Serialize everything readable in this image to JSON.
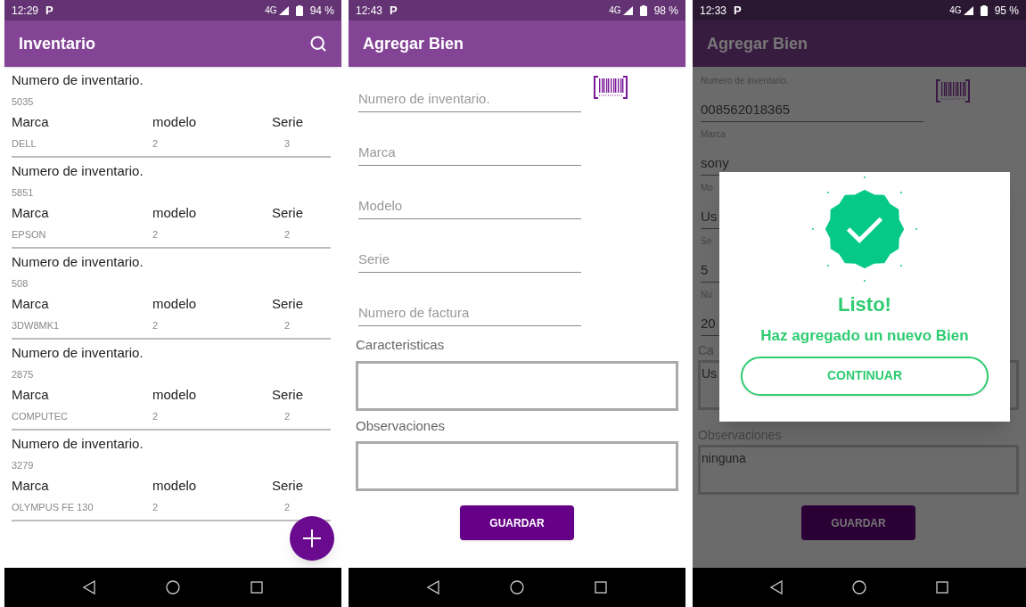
{
  "inventory_screen": {
    "status_bar": {
      "time": "12:29",
      "notification_icon": "P",
      "network": "4G",
      "battery": "94 %"
    },
    "app_bar": {
      "title": "Inventario"
    },
    "items": [
      {
        "number_label": "Numero de inventario.",
        "number": "5035",
        "columns": [
          {
            "header": "Marca",
            "value": "DELL"
          },
          {
            "header": "modelo",
            "value": "2"
          },
          {
            "header": "Serie",
            "value": "3"
          }
        ]
      },
      {
        "number_label": "Numero de inventario.",
        "number": "5851",
        "columns": [
          {
            "header": "Marca",
            "value": "EPSON"
          },
          {
            "header": "modelo",
            "value": "2"
          },
          {
            "header": "Serie",
            "value": "2"
          }
        ]
      },
      {
        "number_label": "Numero de inventario.",
        "number": "508",
        "columns": [
          {
            "header": "Marca",
            "value": "3DW8MK1"
          },
          {
            "header": "modelo",
            "value": "2"
          },
          {
            "header": "Serie",
            "value": "2"
          }
        ]
      },
      {
        "number_label": "Numero de inventario.",
        "number": "2875",
        "columns": [
          {
            "header": "Marca",
            "value": "COMPUTEC"
          },
          {
            "header": "modelo",
            "value": "2"
          },
          {
            "header": "Serie",
            "value": "2"
          }
        ]
      },
      {
        "number_label": "Numero de inventario.",
        "number": "3279",
        "columns": [
          {
            "header": "Marca",
            "value": "OLYMPUS FE 130"
          },
          {
            "header": "modelo",
            "value": "2"
          },
          {
            "header": "Serie",
            "value": "2"
          }
        ]
      }
    ]
  },
  "add_screen": {
    "status_bar": {
      "time": "12:43",
      "notification_icon": "P",
      "network": "4G",
      "battery": "98 %"
    },
    "app_bar": {
      "title": "Agregar Bien"
    },
    "fields": [
      {
        "placeholder": "Numero de inventario.",
        "scan": true
      },
      {
        "placeholder": "Marca",
        "scan": false
      },
      {
        "placeholder": "Modelo",
        "scan": false
      },
      {
        "placeholder": "Serie",
        "scan": false
      },
      {
        "placeholder": "Numero de factura",
        "scan": false
      }
    ],
    "text_areas": [
      {
        "label": "Caracteristicas"
      },
      {
        "label": "Observaciones"
      }
    ],
    "save_button": "GUARDAR"
  },
  "success_screen": {
    "status_bar": {
      "time": "12:33",
      "notification_icon": "P",
      "network": "4G",
      "battery": "95 %"
    },
    "app_bar": {
      "title": "Agregar Bien"
    },
    "fields": [
      {
        "label": "Numero de inventario.",
        "value": "008562018365",
        "scan": true
      },
      {
        "label": "Marca",
        "value": "sony",
        "scan": false
      },
      {
        "label": "Mo",
        "value": "Us",
        "scan": false
      },
      {
        "label": "Se",
        "value": "5",
        "scan": false
      },
      {
        "label": "Nu",
        "value": "20",
        "scan": false
      }
    ],
    "text_areas": [
      {
        "label": "Ca",
        "value": "Us"
      },
      {
        "label": "Observaciones",
        "value": "ninguna"
      }
    ],
    "save_button": "GUARDAR",
    "dialog": {
      "title": "Listo!",
      "message": "Haz agregado un nuevo Bien",
      "button": "CONTINUAR"
    }
  }
}
